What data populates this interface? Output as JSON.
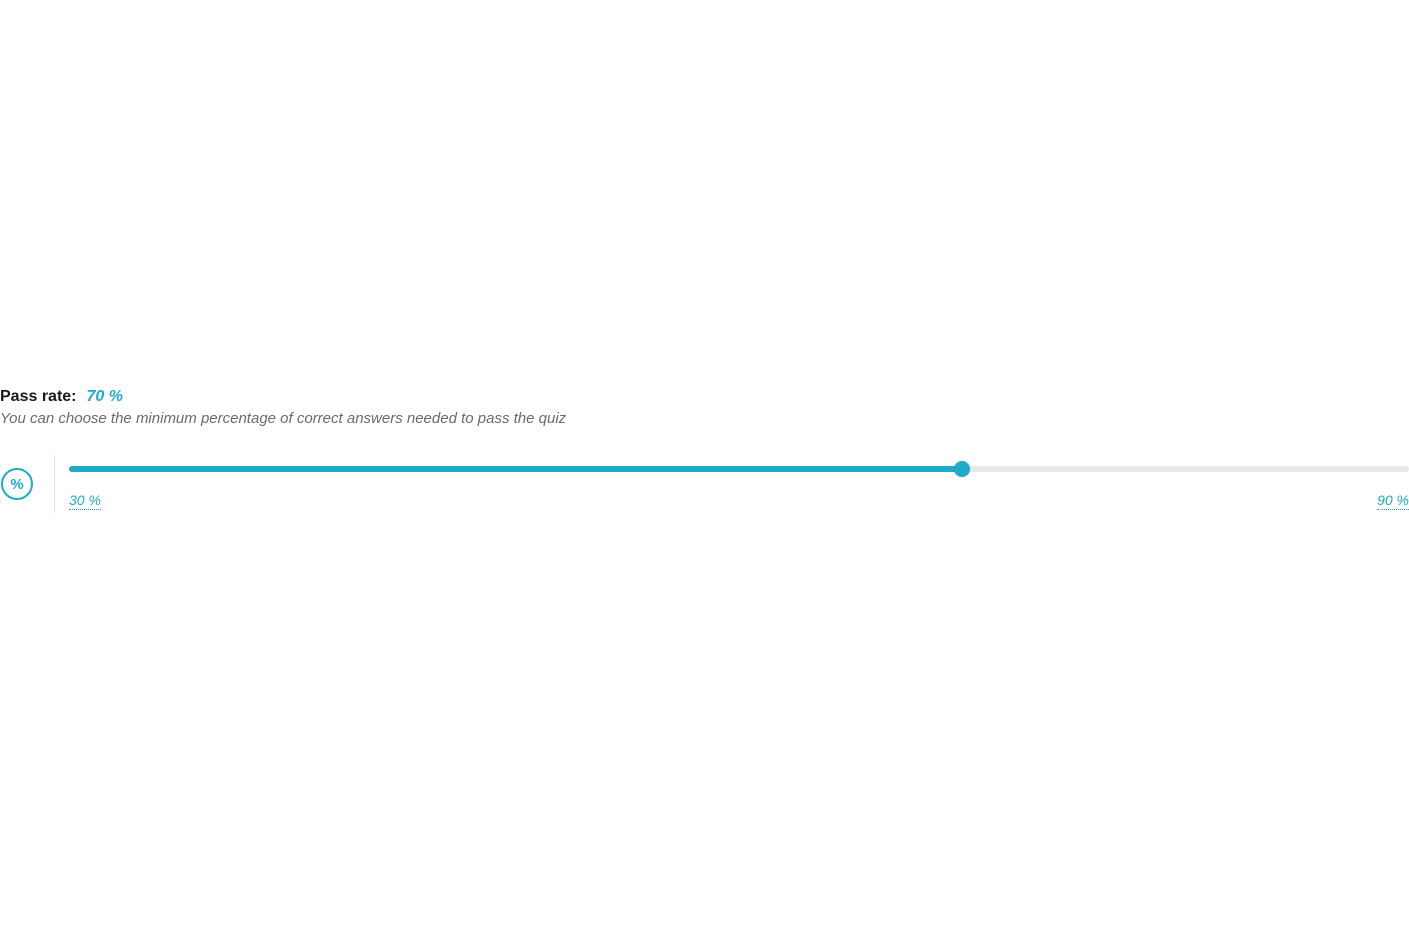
{
  "passRate": {
    "label": "Pass rate:",
    "value": "70 %",
    "description": "You can choose the minimum percentage of correct answers needed to pass the quiz",
    "iconGlyph": "%",
    "slider": {
      "min": 30,
      "max": 90,
      "current": 70,
      "minLabel": "30 %",
      "maxLabel": "90 %"
    },
    "colors": {
      "accent": "#1eabc7"
    }
  }
}
